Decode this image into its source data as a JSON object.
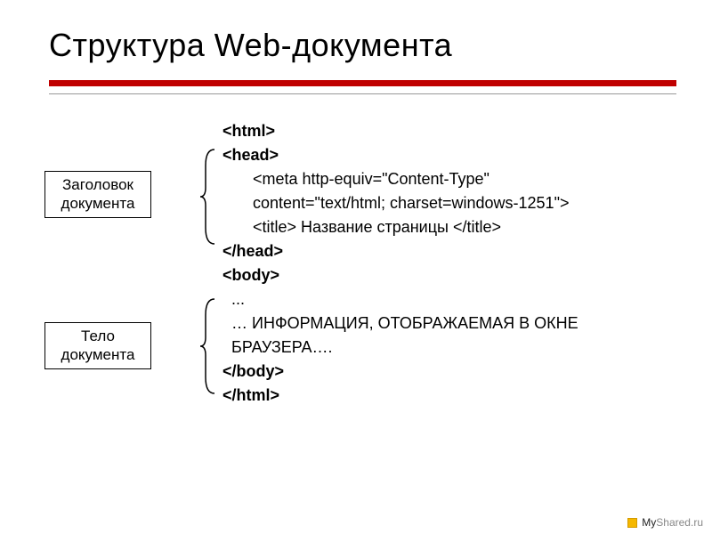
{
  "title": "Структура Web-документа",
  "labels": {
    "head": "Заголовок документа",
    "body": "Тело документа"
  },
  "code": {
    "html_open": "<html>",
    "head_open": "<head>",
    "meta_line1": "<meta http-equiv=\"Content-Type\"",
    "meta_line2": "content=\"text/html; charset=windows-1251\">",
    "title_line": "<title> Название страницы </title>",
    "head_close": "</head>",
    "body_open": "<body>",
    "body_content1": "...",
    "body_content2": "… ИНФОРМАЦИЯ, ОТОБРАЖАЕМАЯ В ОКНЕ",
    "body_content3": "БРАУЗЕРА….",
    "body_close": "</body>",
    "html_close": "</html>"
  },
  "footer": {
    "brand_my": "My",
    "brand_shared": "Shared",
    "brand_ru": ".ru"
  }
}
